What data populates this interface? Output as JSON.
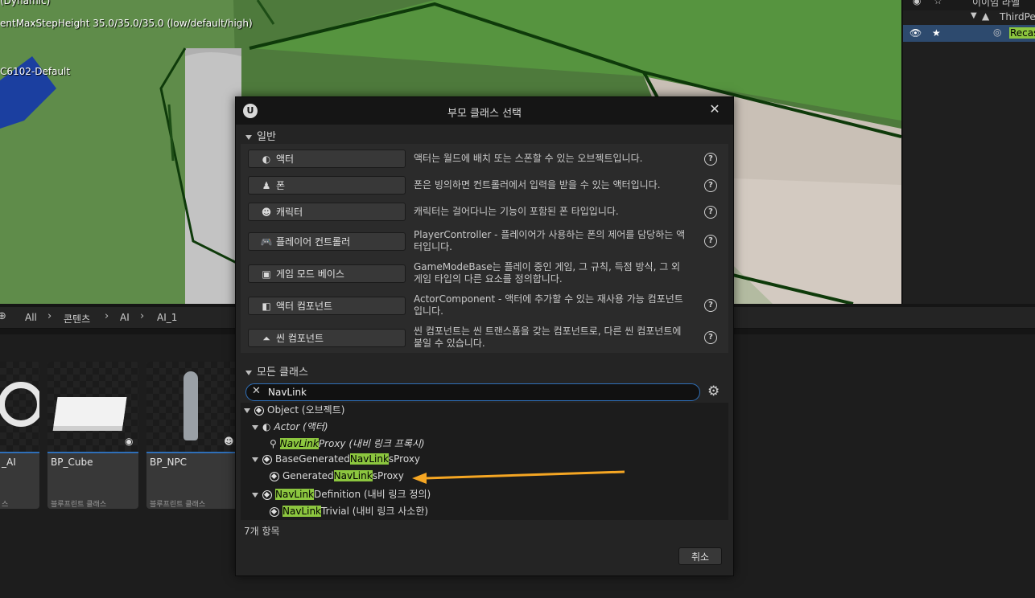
{
  "viewport": {
    "overlay_lines": [
      "(Dynamic)",
      "entMaxStepHeight 35.0/35.0/35.0 (low/default/high)",
      "C6102-Default"
    ]
  },
  "outliner": {
    "header_partial": "이이임 라벨",
    "rows": [
      {
        "label": "ThirdPe",
        "selected": false
      },
      {
        "label": "Recas",
        "selected": true
      }
    ]
  },
  "path_bar": {
    "crumbs": [
      "All",
      "콘텐츠",
      "AI",
      "AI_1"
    ]
  },
  "assets": [
    {
      "name": "_AI",
      "type": "스"
    },
    {
      "name": "BP_Cube",
      "type": "블루프린트 클래스"
    },
    {
      "name": "BP_NPC",
      "type": "블루프린트 클래스"
    }
  ],
  "dialog": {
    "title": "부모 클래스 선택",
    "common_section_label": "일반",
    "common_classes": [
      {
        "label": "액터",
        "icon": "actor-icon",
        "desc": "액터는 월드에 배치 또는 스폰할 수 있는 오브젝트입니다."
      },
      {
        "label": "폰",
        "icon": "pawn-icon",
        "desc": "폰은 빙의하면 컨트롤러에서 입력을 받을 수 있는 액터입니다."
      },
      {
        "label": "캐릭터",
        "icon": "character-icon",
        "desc": "캐릭터는 걸어다니는 기능이 포함된 폰 타입입니다."
      },
      {
        "label": "플레이어 컨트롤러",
        "icon": "gamepad-icon",
        "desc": "PlayerController - 플레이어가 사용하는 폰의 제어를 담당하는 액터입니다."
      },
      {
        "label": "게임 모드 베이스",
        "icon": "game-mode-icon",
        "desc": "GameModeBase는 플레이 중인 게임, 그 규칙, 득점 방식, 그 외 게임 타입의 다른 요소를 정의합니다."
      },
      {
        "label": "액터 컴포넌트",
        "icon": "component-icon",
        "desc": "ActorComponent - 액터에 추가할 수 있는 재사용 가능 컴포넌트입니다."
      },
      {
        "label": "씬 컴포넌트",
        "icon": "scene-component-icon",
        "desc": "씬 컴포넌트는 씬 트랜스폼을 갖는 컴포넌트로, 다른 씬 컴포넌트에 붙일 수 있습니다."
      }
    ],
    "all_classes_label": "모든 클래스",
    "search_value": "NavLink",
    "tree": [
      {
        "pre": "Object (오브젝트)",
        "hl": "",
        "post": "",
        "italic": false
      },
      {
        "pre": "Actor (액터)",
        "hl": "",
        "post": "",
        "italic": true
      },
      {
        "pre": "",
        "hl": "NavLink",
        "post": "Proxy (내비 링크 프록시)",
        "italic": true
      },
      {
        "pre": "BaseGenerated",
        "hl": "NavLink",
        "post": "sProxy",
        "italic": false
      },
      {
        "pre": "Generated",
        "hl": "NavLink",
        "post": "sProxy",
        "italic": false
      },
      {
        "pre": "",
        "hl": "NavLink",
        "post": "Definition (내비 링크 정의)",
        "italic": false
      },
      {
        "pre": "",
        "hl": "NavLink",
        "post": "Trivial (내비 링크 사소한)",
        "italic": false
      }
    ],
    "item_count": "7개 항목",
    "cancel_label": "취소"
  },
  "colors": {
    "highlight": "#8cc63f",
    "arrow": "#f5a623",
    "focus_blue": "#2f6fb8"
  }
}
